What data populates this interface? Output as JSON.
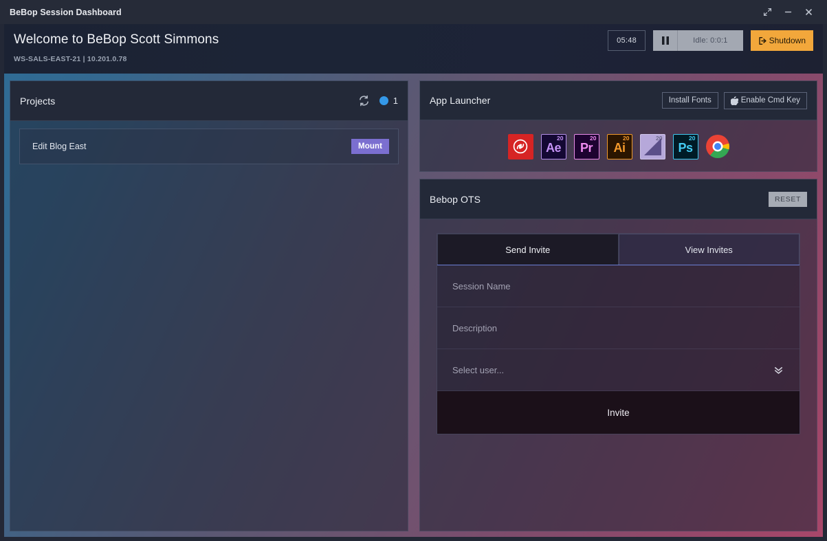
{
  "window": {
    "title": "BeBop Session Dashboard",
    "controls": [
      {
        "name": "expand-icon",
        "label": "Expand"
      },
      {
        "name": "minimize-icon",
        "label": "Minimize"
      },
      {
        "name": "close-icon",
        "label": "Close"
      }
    ]
  },
  "welcome": {
    "title": "Welcome to BeBop Scott Simmons",
    "subtitle": "WS-SALS-EAST-21 | 10.201.0.78"
  },
  "session_controls": {
    "timer": "05:48",
    "pause_icon": "pause-icon",
    "idle_label": "Idle: 0:0:1",
    "shutdown_label": "Shutdown",
    "shutdown_color": "#f2a73b"
  },
  "projects": {
    "title": "Projects",
    "refresh_icon": "refresh-icon",
    "status_dot_color": "#3498e8",
    "count": "1",
    "rows": [
      {
        "name": "Edit Blog East",
        "action_label": "Mount",
        "action_color": "#7b6fd0"
      }
    ]
  },
  "app_launcher": {
    "title": "App Launcher",
    "install_fonts_label": "Install Fonts",
    "enable_cmd_key_label": "Enable Cmd Key",
    "apple_icon": "apple-icon",
    "apps": [
      {
        "name": "adobe-creative-cloud-icon",
        "mark": "",
        "version": "",
        "class": "ai-cc",
        "text_class": ""
      },
      {
        "name": "adobe-after-effects-icon",
        "mark": "Ae",
        "version": "20",
        "class": "ai-ae",
        "text_class": "c-ae"
      },
      {
        "name": "adobe-premiere-pro-icon",
        "mark": "Pr",
        "version": "20",
        "class": "ai-pr",
        "text_class": "c-pr"
      },
      {
        "name": "adobe-illustrator-icon",
        "mark": "Ai",
        "version": "20",
        "class": "ai-ai",
        "text_class": "c-ai"
      },
      {
        "name": "adobe-media-encoder-icon",
        "mark": "",
        "version": "20",
        "class": "ai-me",
        "text_class": ""
      },
      {
        "name": "adobe-photoshop-icon",
        "mark": "Ps",
        "version": "20",
        "class": "ai-ps",
        "text_class": "c-ps"
      },
      {
        "name": "google-chrome-icon",
        "mark": "",
        "version": "",
        "class": "",
        "text_class": ""
      }
    ]
  },
  "ots": {
    "title": "Bebop OTS",
    "reset_label": "RESET",
    "tabs": [
      {
        "label": "Send Invite",
        "active": true
      },
      {
        "label": "View Invites",
        "active": false
      }
    ],
    "fields": [
      {
        "name": "session-name-input",
        "placeholder": "Session Name"
      },
      {
        "name": "description-input",
        "placeholder": "Description"
      },
      {
        "name": "user-select",
        "placeholder": "Select user...",
        "chevron_icon": "chevron-double-down-icon"
      }
    ],
    "submit_label": "Invite"
  }
}
